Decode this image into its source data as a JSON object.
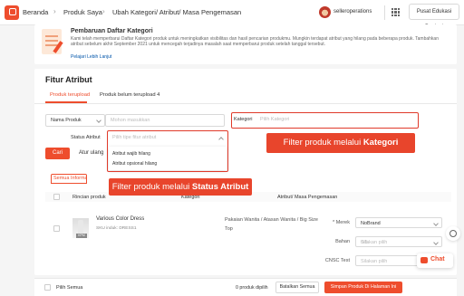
{
  "breadcrumb": {
    "home": "Beranda",
    "products": "Produk Saya",
    "current": "Ubah Kategori/ Atribut/ Masa Pengemasan"
  },
  "header": {
    "seller": "selleroperations",
    "edu_button": "Pusat Edukasi Penjual"
  },
  "notice": {
    "title": "Pembaruan Daftar Kategori",
    "body": "Kami telah memperbarui Daftar Kategori produk untuk meningkatkan visibilitas dan hasil pencarian produkmu. Mungkin terdapat atribut yang hilang pada beberapa produk. Tambahkan atribut sebelum akhir September 2021 untuk mencegah terjadinya masalah saat memperbarui produk setelah tanggal tersebut.",
    "link": "Pelajari Lebih Lanjut"
  },
  "panel": {
    "title": "Fitur Atribut",
    "tabs": [
      "Produk terupload",
      "Produk belum terupload 4"
    ]
  },
  "filters": {
    "field_select": "Nama Produk",
    "search_placeholder": "Mohon masukkan",
    "category_label": "Kategori",
    "category_placeholder": "Pilih Kategori",
    "status_label": "Status Atribut",
    "status_placeholder": "Pilih tipe fitur atribut",
    "status_options": [
      "Atribut wajib hilang",
      "Atribut opsional hilang"
    ],
    "search_button": "Cari",
    "reset_button": "Atur ulang"
  },
  "callouts": {
    "kategori": {
      "prefix": "Filter produk melalui ",
      "bold": "Kategori"
    },
    "status": {
      "prefix": "Filter produk melalui ",
      "bold": "Status Atribut"
    }
  },
  "subtab": "Semua Informasi",
  "table": {
    "headers": [
      "Rincian produk",
      "Kategori",
      "Atribut/ Masa Pengemasan"
    ],
    "row": {
      "name": "Various Color Dress",
      "sku": "SKU induk: DRESS1",
      "thumb_tag": "KPM",
      "category": "Pakaian Wanita / Atasan Wanita / Big Size Top",
      "attributes": [
        {
          "label": "* Merek",
          "value": "NoBrand",
          "counter": ""
        },
        {
          "label": "Bahan",
          "value": "Silakan pilih",
          "counter": "0/5"
        },
        {
          "label": "CNSC Test",
          "value": "Silakan pilih",
          "counter": ""
        }
      ]
    }
  },
  "footer": {
    "select_all": "Pilih Semua",
    "selected_count": "0 produk dipilih",
    "cancel_button": "Batalkan Semua",
    "save_button": "Simpan Produk Di Halaman Ini"
  },
  "chat": {
    "label": "Chat"
  },
  "colors": {
    "accent": "#ee4d2d",
    "callout": "#e8452c"
  }
}
